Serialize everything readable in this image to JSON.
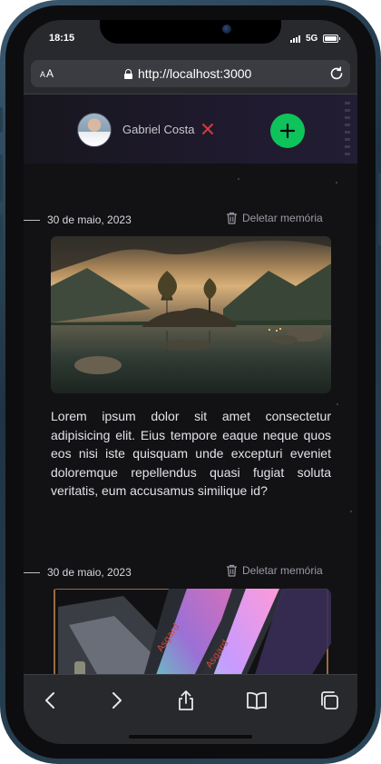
{
  "status_bar": {
    "time": "18:15",
    "network": "5G"
  },
  "browser": {
    "text_size_label": "AA",
    "url": "http://localhost:3000"
  },
  "header": {
    "user_name": "Gabriel Costa"
  },
  "memories": [
    {
      "date": "30 de maio, 2023",
      "delete_label": "Deletar memória",
      "image": "lake-landscape-photo",
      "text": "Lorem ipsum dolor sit amet consectetur adipisicing elit. Eius tempore eaque neque quos eos nisi iste quisquam unde excepturi eveniet doloremque repellendus quasi fugiat soluta veritatis, eum accusamus similique id?"
    },
    {
      "date": "30 de maio, 2023",
      "delete_label": "Deletar memória",
      "image": "rgb-ram-photo"
    }
  ],
  "ram_label": "Asgard",
  "icons": {
    "lock": "lock-icon",
    "reload": "reload-icon",
    "logout": "close-icon",
    "add": "plus-icon",
    "delete": "trash-icon",
    "back": "chevron-left-icon",
    "forward": "chevron-right-icon",
    "share": "share-icon",
    "bookmarks": "book-icon",
    "tabs": "tabs-icon"
  },
  "colors": {
    "accent": "#0ec35a",
    "logout_x": "#d23b3b",
    "background": "#121215"
  }
}
